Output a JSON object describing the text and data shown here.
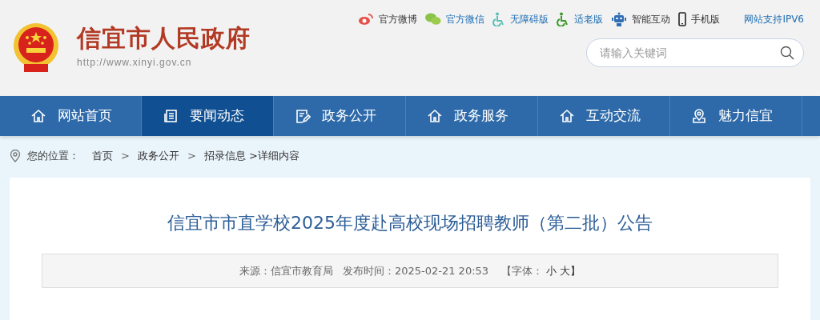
{
  "header": {
    "site_title": "信宜市人民政府",
    "site_url": "http://www.xinyi.gov.cn",
    "top_links": [
      {
        "kind": "weibo",
        "label": "官方微博"
      },
      {
        "kind": "wechat",
        "label": "官方微信"
      },
      {
        "kind": "accessible",
        "label": "无障碍版"
      },
      {
        "kind": "elderly",
        "label": "适老版"
      },
      {
        "kind": "robot",
        "label": "智能互动"
      },
      {
        "kind": "phone",
        "label": "手机版"
      },
      {
        "kind": "text",
        "label": "网站支持IPV6"
      }
    ],
    "search": {
      "placeholder": "请输入关键词"
    }
  },
  "nav": [
    {
      "kind": "home",
      "label": "网站首页",
      "selected": false
    },
    {
      "kind": "news",
      "label": "要闻动态",
      "selected": true
    },
    {
      "kind": "doc",
      "label": "政务公开",
      "selected": false
    },
    {
      "kind": "home",
      "label": "政务服务",
      "selected": false
    },
    {
      "kind": "home",
      "label": "互动交流",
      "selected": false
    },
    {
      "kind": "pin",
      "label": "魅力信宜",
      "selected": false
    }
  ],
  "breadcrumb": {
    "label": "您的位置：",
    "items": [
      {
        "kind": "link",
        "text": "首页"
      },
      {
        "kind": "separator",
        "text": ">"
      },
      {
        "kind": "link",
        "text": "政务公开"
      },
      {
        "kind": "separator",
        "text": ">"
      },
      {
        "kind": "link",
        "text": "招录信息 >详细内容"
      }
    ]
  },
  "article": {
    "title": "信宜市市直学校2025年度赴高校现场招聘教师（第二批）公告",
    "source": "来源：信宜市教育局",
    "published": "发布时间：2025-02-21 20:53",
    "font_label": "【字体：",
    "font_small": "小",
    "font_large": "大】"
  }
}
